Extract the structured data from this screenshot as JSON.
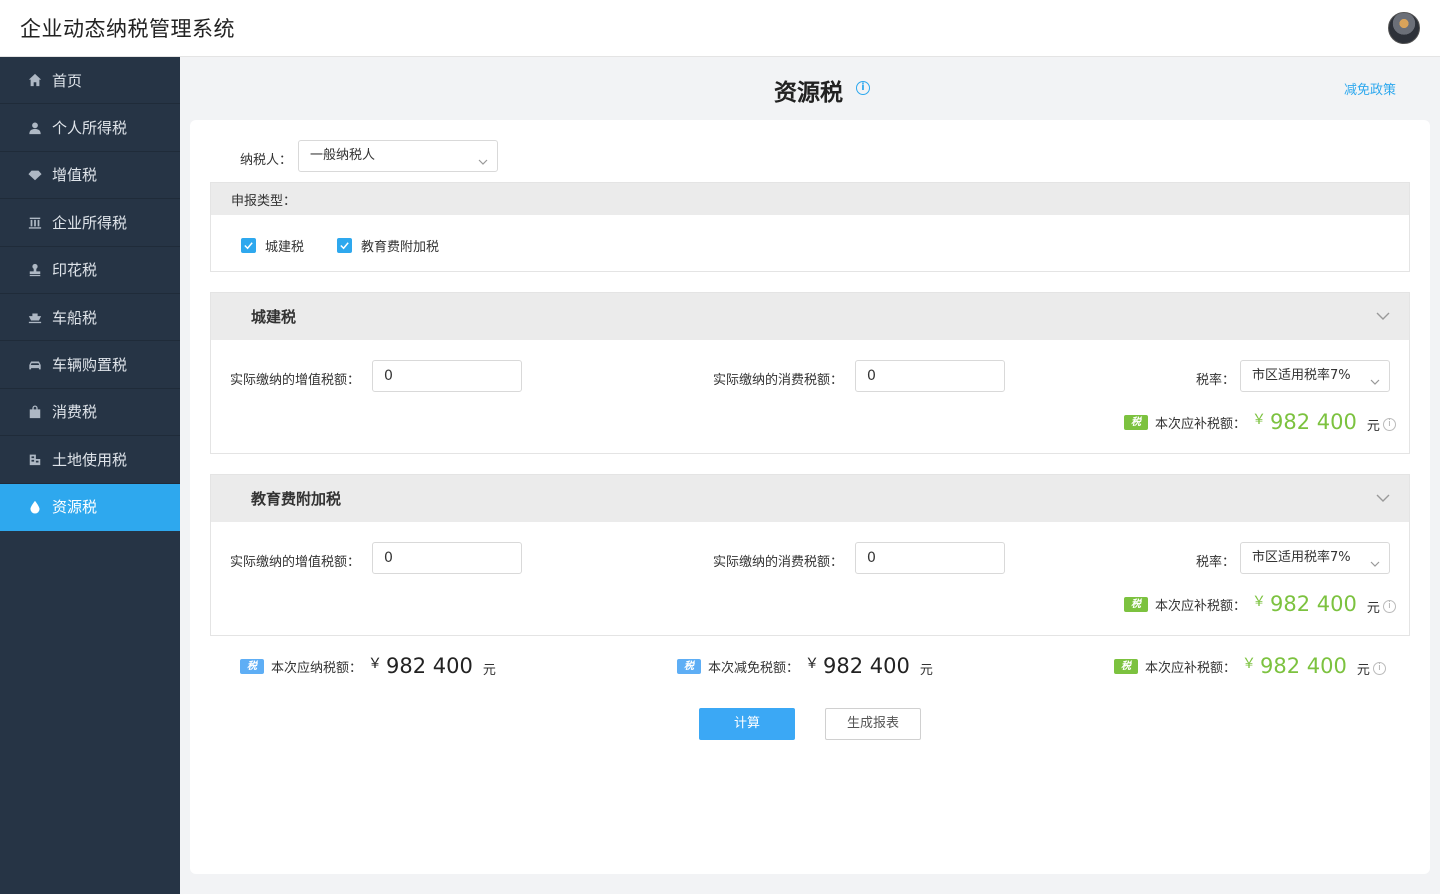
{
  "app": {
    "title": "企业动态纳税管理系统"
  },
  "sidebar": {
    "items": [
      {
        "label": "首页",
        "icon": "home-icon"
      },
      {
        "label": "个人所得税",
        "icon": "user-icon"
      },
      {
        "label": "增值税",
        "icon": "diamond-icon"
      },
      {
        "label": "企业所得税",
        "icon": "building-icon"
      },
      {
        "label": "印花税",
        "icon": "stamp-icon"
      },
      {
        "label": "车船税",
        "icon": "boat-icon"
      },
      {
        "label": "车辆购置税",
        "icon": "car-icon"
      },
      {
        "label": "消费税",
        "icon": "bag-icon"
      },
      {
        "label": "土地使用税",
        "icon": "land-icon"
      },
      {
        "label": "资源税",
        "icon": "drop-icon",
        "active": true
      }
    ]
  },
  "page": {
    "title": "资源税",
    "info_icon": "i",
    "policy_link": "减免政策"
  },
  "taxpayer": {
    "label": "纳税人：",
    "value": "一般纳税人"
  },
  "declare": {
    "label": "申报类型：",
    "options": [
      {
        "label": "城建税",
        "checked": true
      },
      {
        "label": "教育费附加税",
        "checked": true
      }
    ]
  },
  "sections": [
    {
      "title": "城建税",
      "vat_label": "实际缴纳的增值税额：",
      "vat_value": "0",
      "consumption_label": "实际缴纳的消费税额：",
      "consumption_value": "0",
      "rate_label": "税率：",
      "rate_value": "市区适用税率7%",
      "tag": "税",
      "due_label": "本次应补税额：",
      "currency": "￥",
      "due_amount": "982 400",
      "unit": "元"
    },
    {
      "title": "教育费附加税",
      "vat_label": "实际缴纳的增值税额：",
      "vat_value": "0",
      "consumption_label": "实际缴纳的消费税额：",
      "consumption_value": "0",
      "rate_label": "税率：",
      "rate_value": "市区适用税率7%",
      "tag": "税",
      "due_label": "本次应补税额：",
      "currency": "￥",
      "due_amount": "982 400",
      "unit": "元"
    }
  ],
  "totals": [
    {
      "tag": "税",
      "label": "本次应纳税额：",
      "currency": "￥",
      "amount": "982 400",
      "unit": "元"
    },
    {
      "tag": "税",
      "label": "本次减免税额：",
      "currency": "￥",
      "amount": "982 400",
      "unit": "元"
    },
    {
      "tag": "税",
      "label": "本次应补税额：",
      "currency": "￥",
      "amount": "982 400",
      "unit": "元"
    }
  ],
  "actions": {
    "calculate": "计算",
    "report": "生成报表"
  },
  "colors": {
    "accent": "#2ea8ee",
    "green": "#7cc23f",
    "sidebar": "#263445"
  }
}
